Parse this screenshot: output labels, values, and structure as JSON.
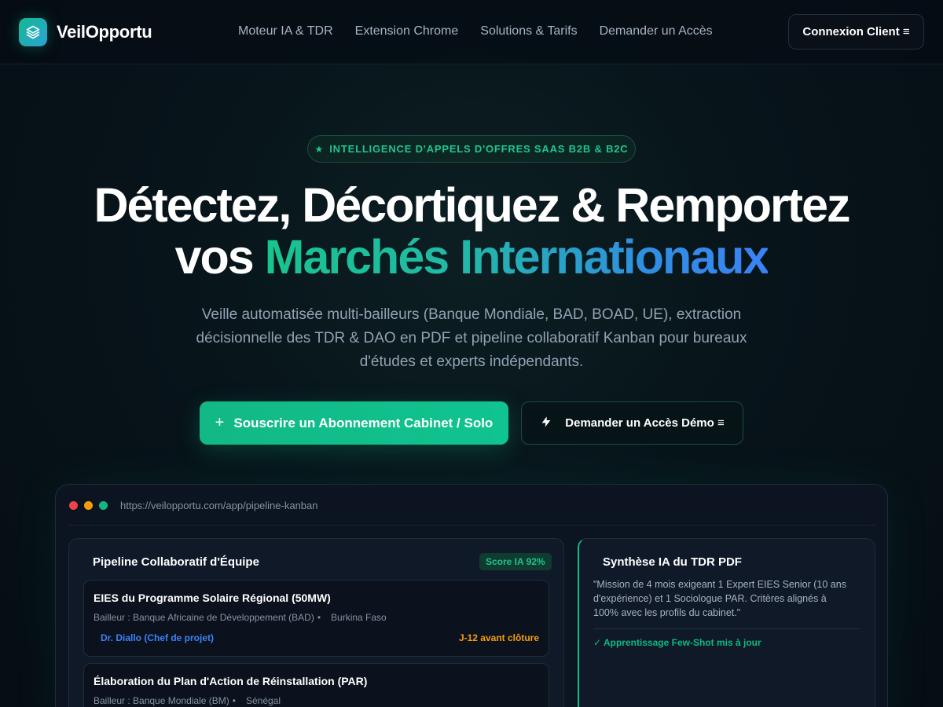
{
  "brand": {
    "name": "VeilOpportu",
    "logo_icon": "layers-icon"
  },
  "nav": {
    "links": [
      "Moteur IA & TDR",
      "Extension Chrome",
      "Solutions & Tarifs",
      "Demander un Accès"
    ],
    "login_label": "Connexion Client ≡"
  },
  "hero": {
    "badge_icon": "star-icon",
    "badge": "INTELLIGENCE D'APPELS D'OFFRES SAAS B2B & B2C",
    "title_line1": "Détectez, Décortiquez & Remportez",
    "title_line2_plain": "vos ",
    "title_line2_gradient": "Marchés Internationaux",
    "subtitle": "Veille automatisée multi-bailleurs (Banque Mondiale, BAD, BOAD, UE), extraction décisionnelle des TDR & DAO en PDF et pipeline collaboratif Kanban pour bureaux d'études et experts indépendants.",
    "cta_primary": "Souscrire un Abonnement Cabinet / Solo",
    "cta_primary_icon": "+",
    "cta_secondary": "Demander un Accès Démo ≡",
    "cta_secondary_icon": "lightning-icon"
  },
  "preview": {
    "url": "https://veilopportu.com/app/pipeline-kanban",
    "pipeline": {
      "title": "Pipeline Collaboratif d'Équipe",
      "score": "Score IA 92%",
      "cards": [
        {
          "title": "EIES du Programme Solaire Régional (50MW)",
          "donor": "Bailleur : Banque Africaine de Développement (BAD)",
          "country": "Burkina Faso",
          "owner": "Dr. Diallo (Chef de projet)",
          "deadline": "J-12 avant clôture"
        },
        {
          "title": "Élaboration du Plan d'Action de Réinstallation (PAR)",
          "donor": "Bailleur : Banque Mondiale (BM)",
          "country": "Sénégal",
          "owner": "",
          "deadline": ""
        }
      ]
    },
    "ai_summary": {
      "title": "Synthèse IA du TDR PDF",
      "quote": "\"Mission de 4 mois exigeant 1 Expert EIES Senior (10 ans d'expérience) et 1 Sociologue PAR. Critères alignés à 100% avec les profils du cabinet.\"",
      "status": "✓ Apprentissage Few-Shot mis à jour"
    }
  },
  "colors": {
    "accent": "#10b981",
    "blue": "#3b82f6",
    "warning": "#f59e0b",
    "background": "#060d14"
  }
}
